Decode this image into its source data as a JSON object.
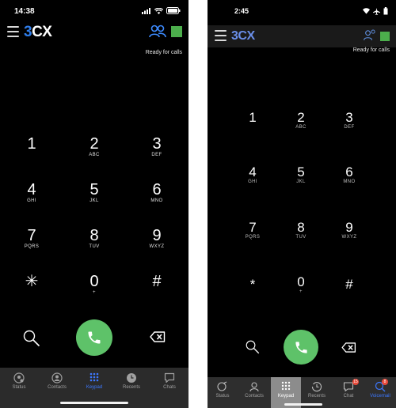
{
  "left": {
    "status_time": "14:38",
    "logo_prefix": "3",
    "logo_suffix": "CX",
    "ready_text": "Ready for calls",
    "keys": [
      {
        "digit": "1",
        "sub": ""
      },
      {
        "digit": "2",
        "sub": "ABC"
      },
      {
        "digit": "3",
        "sub": "DEF"
      },
      {
        "digit": "4",
        "sub": "GHI"
      },
      {
        "digit": "5",
        "sub": "JKL"
      },
      {
        "digit": "6",
        "sub": "MNO"
      },
      {
        "digit": "7",
        "sub": "PQRS"
      },
      {
        "digit": "8",
        "sub": "TUV"
      },
      {
        "digit": "9",
        "sub": "WXYZ"
      },
      {
        "digit": "✳",
        "sub": ""
      },
      {
        "digit": "0",
        "sub": "+"
      },
      {
        "digit": "#",
        "sub": ""
      }
    ],
    "tabs": [
      {
        "label": "Status",
        "icon": "status-icon"
      },
      {
        "label": "Contacts",
        "icon": "contacts-icon"
      },
      {
        "label": "Keypad",
        "icon": "keypad-icon"
      },
      {
        "label": "Recents",
        "icon": "recents-icon"
      },
      {
        "label": "Chats",
        "icon": "chats-icon"
      }
    ],
    "active_tab": "Keypad"
  },
  "right": {
    "status_time": "2:45",
    "logo_prefix": "3",
    "logo_suffix": "CX",
    "ready_text": "Ready for calls",
    "keys": [
      {
        "digit": "1",
        "sub": ""
      },
      {
        "digit": "2",
        "sub": "ABC"
      },
      {
        "digit": "3",
        "sub": "DEF"
      },
      {
        "digit": "4",
        "sub": "GHI"
      },
      {
        "digit": "5",
        "sub": "JKL"
      },
      {
        "digit": "6",
        "sub": "MNO"
      },
      {
        "digit": "7",
        "sub": "PQRS"
      },
      {
        "digit": "8",
        "sub": "TUV"
      },
      {
        "digit": "9",
        "sub": "WXYZ"
      },
      {
        "digit": "*",
        "sub": ""
      },
      {
        "digit": "0",
        "sub": "+"
      },
      {
        "digit": "#",
        "sub": ""
      }
    ],
    "tabs": [
      {
        "label": "Status",
        "icon": "status-icon"
      },
      {
        "label": "Contacts",
        "icon": "contacts-icon"
      },
      {
        "label": "Keypad",
        "icon": "keypad-icon"
      },
      {
        "label": "Recents",
        "icon": "recents-icon"
      },
      {
        "label": "Chat",
        "icon": "chat-icon",
        "badge": "15"
      },
      {
        "label": "Voicemail",
        "icon": "voicemail-icon",
        "badge": "8"
      }
    ],
    "active_tab": "Keypad"
  },
  "colors": {
    "call_green": "#5ec269",
    "presence_green": "#4cae4c",
    "accent_blue": "#2f7dea",
    "badge_red": "#e84a3a"
  }
}
